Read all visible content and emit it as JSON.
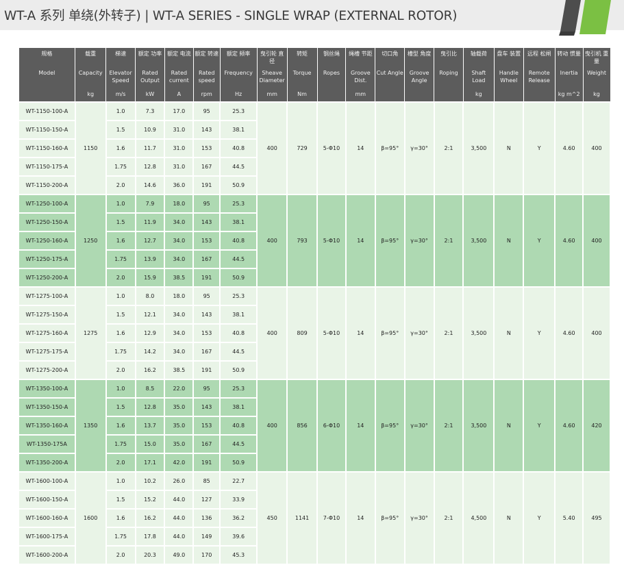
{
  "title": "WT-A 系列 单绕(外转子) | WT-A SERIES - SINGLE WRAP (EXTERNAL ROTOR)",
  "colors": {
    "header_bg": "#5c5c5c",
    "group_light": "#e9f4e7",
    "group_dark": "#aed9b2",
    "logo_green": "#7bc043",
    "logo_dark": "#4d4d4d"
  },
  "columns": [
    {
      "zh": "规格",
      "en": "Model",
      "unit": ""
    },
    {
      "zh": "载重",
      "en": "Capacity",
      "unit": "kg"
    },
    {
      "zh": "梯速",
      "en": "Elevator Speed",
      "unit": "m/s"
    },
    {
      "zh": "额定 功率",
      "en": "Rated Output",
      "unit": "kW"
    },
    {
      "zh": "额定 电流",
      "en": "Rated current",
      "unit": "A"
    },
    {
      "zh": "额定 转速",
      "en": "Rated speed",
      "unit": "rpm"
    },
    {
      "zh": "额定 频率",
      "en": "Frequency",
      "unit": "Hz"
    },
    {
      "zh": "曳引轮 直径",
      "en": "Sheave Diameter",
      "unit": "mm"
    },
    {
      "zh": "转矩",
      "en": "Torque",
      "unit": "Nm"
    },
    {
      "zh": "钢丝绳",
      "en": "Ropes",
      "unit": ""
    },
    {
      "zh": "绳槽 节距",
      "en": "Groove Dist.",
      "unit": "mm"
    },
    {
      "zh": "切口角",
      "en": "Cut Angle",
      "unit": ""
    },
    {
      "zh": "槽型 角度",
      "en": "Groove Angle",
      "unit": ""
    },
    {
      "zh": "曳引比",
      "en": "Roping",
      "unit": ""
    },
    {
      "zh": "轴载荷",
      "en": "Shaft Load",
      "unit": "kg"
    },
    {
      "zh": "盘车 装置",
      "en": "Handle Wheel",
      "unit": ""
    },
    {
      "zh": "远程 松闸",
      "en": "Remote Release",
      "unit": ""
    },
    {
      "zh": "转动 惯量",
      "en": "Inertia",
      "unit": "kg m^2"
    },
    {
      "zh": "曳引机 重量",
      "en": "Weight",
      "unit": "kg"
    }
  ],
  "groups": [
    {
      "capacity": "1150",
      "sheave": "400",
      "torque": "729",
      "ropes": "5-Φ10",
      "groove_dist": "14",
      "cut_angle": "β=95°",
      "groove_angle": "γ=30°",
      "roping": "2:1",
      "shaft_load": "3,500",
      "handle_wheel": "N",
      "remote_release": "Y",
      "inertia": "4.60",
      "weight": "400",
      "rows": [
        {
          "model": "WT-1150-100-A",
          "speed": "1.0",
          "output": "7.3",
          "current": "17.0",
          "rpm": "95",
          "freq": "25.3"
        },
        {
          "model": "WT-1150-150-A",
          "speed": "1.5",
          "output": "10.9",
          "current": "31.0",
          "rpm": "143",
          "freq": "38.1"
        },
        {
          "model": "WT-1150-160-A",
          "speed": "1.6",
          "output": "11.7",
          "current": "31.0",
          "rpm": "153",
          "freq": "40.8"
        },
        {
          "model": "WT-1150-175-A",
          "speed": "1.75",
          "output": "12.8",
          "current": "31.0",
          "rpm": "167",
          "freq": "44.5"
        },
        {
          "model": "WT-1150-200-A",
          "speed": "2.0",
          "output": "14.6",
          "current": "36.0",
          "rpm": "191",
          "freq": "50.9"
        }
      ]
    },
    {
      "capacity": "1250",
      "sheave": "400",
      "torque": "793",
      "ropes": "5-Φ10",
      "groove_dist": "14",
      "cut_angle": "β=95°",
      "groove_angle": "γ=30°",
      "roping": "2:1",
      "shaft_load": "3,500",
      "handle_wheel": "N",
      "remote_release": "Y",
      "inertia": "4.60",
      "weight": "400",
      "rows": [
        {
          "model": "WT-1250-100-A",
          "speed": "1.0",
          "output": "7.9",
          "current": "18.0",
          "rpm": "95",
          "freq": "25.3"
        },
        {
          "model": "WT-1250-150-A",
          "speed": "1.5",
          "output": "11.9",
          "current": "34.0",
          "rpm": "143",
          "freq": "38.1"
        },
        {
          "model": "WT-1250-160-A",
          "speed": "1.6",
          "output": "12.7",
          "current": "34.0",
          "rpm": "153",
          "freq": "40.8"
        },
        {
          "model": "WT-1250-175-A",
          "speed": "1.75",
          "output": "13.9",
          "current": "34.0",
          "rpm": "167",
          "freq": "44.5"
        },
        {
          "model": "WT-1250-200-A",
          "speed": "2.0",
          "output": "15.9",
          "current": "38.5",
          "rpm": "191",
          "freq": "50.9"
        }
      ]
    },
    {
      "capacity": "1275",
      "sheave": "400",
      "torque": "809",
      "ropes": "5-Φ10",
      "groove_dist": "14",
      "cut_angle": "β=95°",
      "groove_angle": "γ=30°",
      "roping": "2:1",
      "shaft_load": "3,500",
      "handle_wheel": "N",
      "remote_release": "Y",
      "inertia": "4.60",
      "weight": "400",
      "rows": [
        {
          "model": "WT-1275-100-A",
          "speed": "1.0",
          "output": "8.0",
          "current": "18.0",
          "rpm": "95",
          "freq": "25.3"
        },
        {
          "model": "WT-1275-150-A",
          "speed": "1.5",
          "output": "12.1",
          "current": "34.0",
          "rpm": "143",
          "freq": "38.1"
        },
        {
          "model": "WT-1275-160-A",
          "speed": "1.6",
          "output": "12.9",
          "current": "34.0",
          "rpm": "153",
          "freq": "40.8"
        },
        {
          "model": "WT-1275-175-A",
          "speed": "1.75",
          "output": "14.2",
          "current": "34.0",
          "rpm": "167",
          "freq": "44.5"
        },
        {
          "model": "WT-1275-200-A",
          "speed": "2.0",
          "output": "16.2",
          "current": "38.5",
          "rpm": "191",
          "freq": "50.9"
        }
      ]
    },
    {
      "capacity": "1350",
      "sheave": "400",
      "torque": "856",
      "ropes": "6-Φ10",
      "groove_dist": "14",
      "cut_angle": "β=95°",
      "groove_angle": "γ=30°",
      "roping": "2:1",
      "shaft_load": "3,500",
      "handle_wheel": "N",
      "remote_release": "Y",
      "inertia": "4.60",
      "weight": "420",
      "rows": [
        {
          "model": "WT-1350-100-A",
          "speed": "1.0",
          "output": "8.5",
          "current": "22.0",
          "rpm": "95",
          "freq": "25.3"
        },
        {
          "model": "WT-1350-150-A",
          "speed": "1.5",
          "output": "12.8",
          "current": "35.0",
          "rpm": "143",
          "freq": "38.1"
        },
        {
          "model": "WT-1350-160-A",
          "speed": "1.6",
          "output": "13.7",
          "current": "35.0",
          "rpm": "153",
          "freq": "40.8"
        },
        {
          "model": "WT-1350-175A",
          "speed": "1.75",
          "output": "15.0",
          "current": "35.0",
          "rpm": "167",
          "freq": "44.5"
        },
        {
          "model": "WT-1350-200-A",
          "speed": "2.0",
          "output": "17.1",
          "current": "42.0",
          "rpm": "191",
          "freq": "50.9"
        }
      ]
    },
    {
      "capacity": "1600",
      "sheave": "450",
      "torque": "1141",
      "ropes": "7-Φ10",
      "groove_dist": "14",
      "cut_angle": "β=95°",
      "groove_angle": "γ=30°",
      "roping": "2:1",
      "shaft_load": "4,500",
      "handle_wheel": "N",
      "remote_release": "Y",
      "inertia": "5.40",
      "weight": "495",
      "rows": [
        {
          "model": "WT-1600-100-A",
          "speed": "1.0",
          "output": "10.2",
          "current": "26.0",
          "rpm": "85",
          "freq": "22.7"
        },
        {
          "model": "WT-1600-150-A",
          "speed": "1.5",
          "output": "15.2",
          "current": "44.0",
          "rpm": "127",
          "freq": "33.9"
        },
        {
          "model": "WT-1600-160-A",
          "speed": "1.6",
          "output": "16.2",
          "current": "44.0",
          "rpm": "136",
          "freq": "36.2"
        },
        {
          "model": "WT-1600-175-A",
          "speed": "1.75",
          "output": "17.8",
          "current": "44.0",
          "rpm": "149",
          "freq": "39.6"
        },
        {
          "model": "WT-1600-200-A",
          "speed": "2.0",
          "output": "20.3",
          "current": "49.0",
          "rpm": "170",
          "freq": "45.3"
        }
      ]
    }
  ]
}
